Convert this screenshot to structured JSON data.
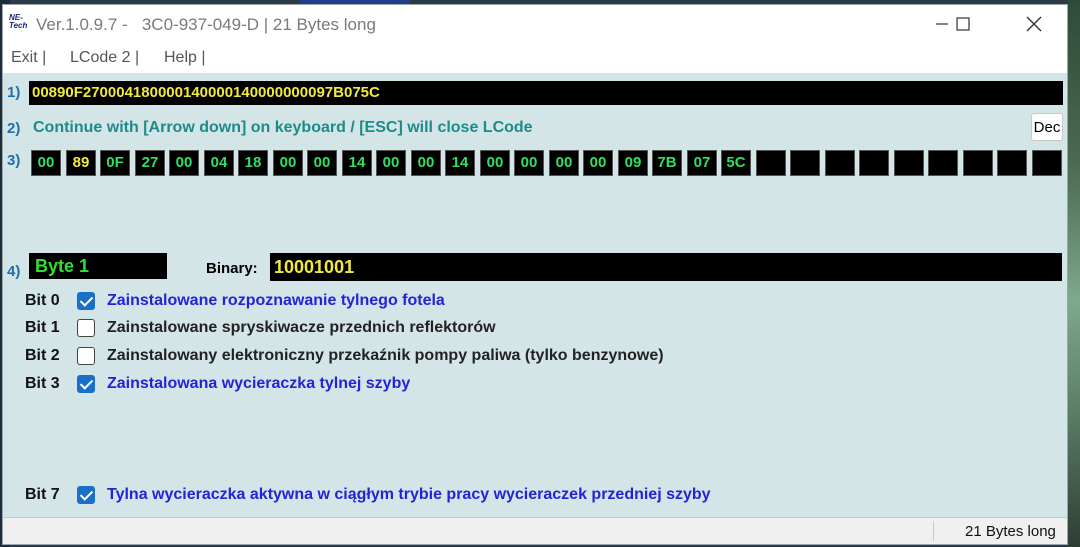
{
  "window": {
    "logo_line1": "NE-",
    "logo_line2": "Tech",
    "title": "Ver.1.0.9.7 -   3C0-937-049-D | 21 Bytes long"
  },
  "menu": [
    {
      "label": "Exit |"
    },
    {
      "label": "LCode 2 |"
    },
    {
      "label": "Help |"
    }
  ],
  "rows": {
    "r1": "1)",
    "r2": "2)",
    "r3": "3)",
    "r4": "4)"
  },
  "hex_string": "00890F270004180000140000140000000097B075C",
  "instruction": "Continue with [Arrow down] on keyboard / [ESC] will close LCode",
  "dec_button": "Dec",
  "bytes": [
    "00",
    "89",
    "0F",
    "27",
    "00",
    "04",
    "18",
    "00",
    "00",
    "14",
    "00",
    "00",
    "14",
    "00",
    "00",
    "00",
    "00",
    "09",
    "7B",
    "07",
    "5C",
    "",
    "",
    "",
    "",
    "",
    "",
    "",
    "",
    ""
  ],
  "selected_byte_index": 1,
  "byte_label": "Byte 1",
  "binary_label": "Binary:",
  "binary_value": "10001001",
  "bits": [
    {
      "label": "Bit 0",
      "checked": true,
      "text": "Zainstalowane rozpoznawanie tylnego fotela"
    },
    {
      "label": "Bit 1",
      "checked": false,
      "text": "Zainstalowane spryskiwacze przednich reflektorów"
    },
    {
      "label": "Bit 2",
      "checked": false,
      "text": "Zainstalowany elektroniczny przekaźnik pompy paliwa (tylko benzynowe)"
    },
    {
      "label": "Bit 3",
      "checked": true,
      "text": "Zainstalowana wycieraczka tylnej szyby"
    },
    {
      "label": "Bit 7",
      "checked": true,
      "text": "Tylna wycieraczka aktywna w ciągłym trybie pracy wycieraczek przedniej szyby"
    }
  ],
  "status": "21 Bytes long",
  "colors": {
    "window_bg": "#d4e5e8",
    "hex_fg": "#f2ea3a",
    "byte_fg": "#30e060",
    "checked_text": "#2323d8",
    "check_accent": "#1a6fc8"
  }
}
